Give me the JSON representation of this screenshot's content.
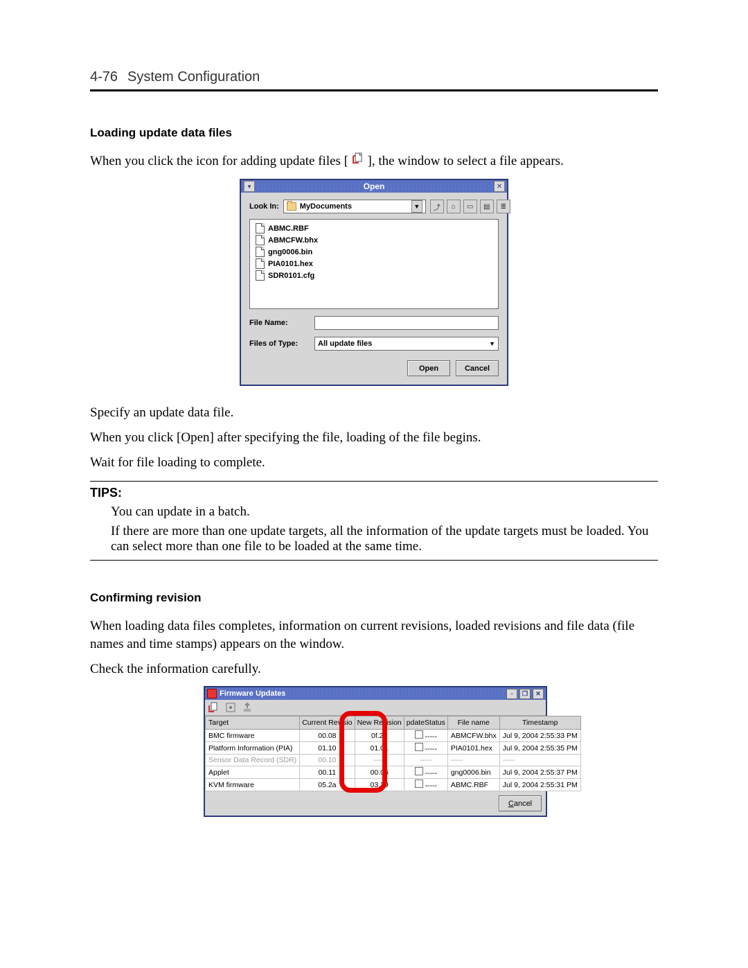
{
  "header": {
    "page_no": "4-76",
    "section": "System Configuration"
  },
  "s1": {
    "title": "Loading update data files",
    "intro_a": "When you click the icon for adding update files [",
    "intro_b": "], the window to select a file appears.",
    "p1": "Specify an update data file.",
    "p2": "When you click [Open] after specifying the file, loading of the file begins.",
    "p3": "Wait for file loading to complete."
  },
  "open_dialog": {
    "title": "Open",
    "look_in_lbl": "Look In:",
    "look_in_val": "MyDocuments",
    "files": [
      "ABMC.RBF",
      "ABMCFW.bhx",
      "gng0006.bin",
      "PIA0101.hex",
      "SDR0101.cfg"
    ],
    "file_name_lbl": "File Name:",
    "file_name_val": "",
    "file_type_lbl": "Files of Type:",
    "file_type_val": "All update files",
    "open_btn": "Open",
    "cancel_btn": "Cancel"
  },
  "tips": {
    "label": "TIPS:",
    "p1": "You can update in a batch.",
    "p2": "If there are more than one update targets, all the information of the update targets must be loaded. You can select more than one file to be loaded at the same time."
  },
  "s2": {
    "title": "Confirming revision",
    "p1": "When loading data files completes, information on current revisions, loaded revisions and file data (file names and time stamps) appears on the window.",
    "p2": "Check the information carefully."
  },
  "fw": {
    "title": "Firmware Updates",
    "cancel_btn": "Cancel",
    "cols": [
      "Target",
      "Current Revisio",
      "New Revision",
      "pdateStatus",
      "File name",
      "Timestamp"
    ],
    "rows": [
      {
        "t": "BMC firmware",
        "cr": "00.08",
        "nr": "0f.21",
        "us": "-----",
        "fn": "ABMCFW.bhx",
        "ts": "Jul 9, 2004 2:55:33 PM",
        "disabled": false
      },
      {
        "t": "Platform Information (PIA)",
        "cr": "01.10",
        "nr": "01.01",
        "us": "-----",
        "fn": "PIA0101.hex",
        "ts": "Jul 9, 2004 2:55:35 PM",
        "disabled": false
      },
      {
        "t": "Sensor Data Record (SDR)",
        "cr": "00.10",
        "nr": "-----",
        "us": "-----",
        "fn": "-----",
        "ts": "-----",
        "disabled": true
      },
      {
        "t": "Applet",
        "cr": "00.11",
        "nr": "00.06",
        "us": "-----",
        "fn": "gng0006.bin",
        "ts": "Jul 9, 2004 2:55:37 PM",
        "disabled": false
      },
      {
        "t": "KVM firmware",
        "cr": "05.2a",
        "nr": "03.29",
        "us": "-----",
        "fn": "ABMC.RBF",
        "ts": "Jul 9, 2004 2:55:31 PM",
        "disabled": false
      }
    ]
  }
}
